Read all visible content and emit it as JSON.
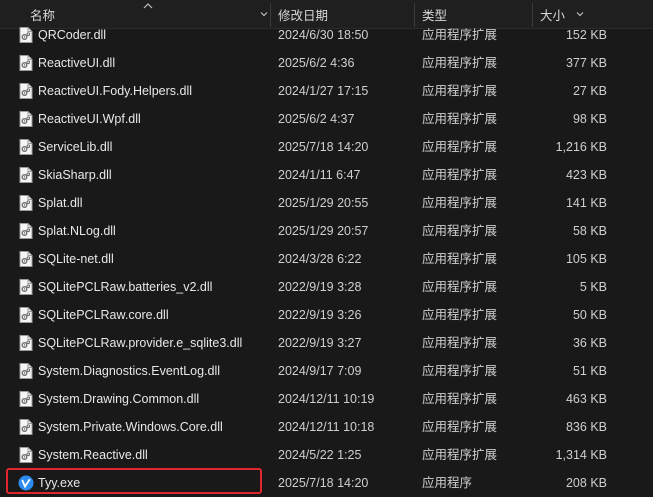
{
  "columns": {
    "name": "名称",
    "date": "修改日期",
    "type": "类型",
    "size": "大小"
  },
  "files": [
    {
      "name": "QRCoder.dll",
      "date": "2024/6/30 18:50",
      "type": "应用程序扩展",
      "size": "152 KB",
      "icon": "dll-icon"
    },
    {
      "name": "ReactiveUI.dll",
      "date": "2025/6/2 4:36",
      "type": "应用程序扩展",
      "size": "377 KB",
      "icon": "dll-icon"
    },
    {
      "name": "ReactiveUI.Fody.Helpers.dll",
      "date": "2024/1/27 17:15",
      "type": "应用程序扩展",
      "size": "27 KB",
      "icon": "dll-icon"
    },
    {
      "name": "ReactiveUI.Wpf.dll",
      "date": "2025/6/2 4:37",
      "type": "应用程序扩展",
      "size": "98 KB",
      "icon": "dll-icon"
    },
    {
      "name": "ServiceLib.dll",
      "date": "2025/7/18 14:20",
      "type": "应用程序扩展",
      "size": "1,216 KB",
      "icon": "dll-icon"
    },
    {
      "name": "SkiaSharp.dll",
      "date": "2024/1/11 6:47",
      "type": "应用程序扩展",
      "size": "423 KB",
      "icon": "dll-icon"
    },
    {
      "name": "Splat.dll",
      "date": "2025/1/29 20:55",
      "type": "应用程序扩展",
      "size": "141 KB",
      "icon": "dll-icon"
    },
    {
      "name": "Splat.NLog.dll",
      "date": "2025/1/29 20:57",
      "type": "应用程序扩展",
      "size": "58 KB",
      "icon": "dll-icon"
    },
    {
      "name": "SQLite-net.dll",
      "date": "2024/3/28 6:22",
      "type": "应用程序扩展",
      "size": "105 KB",
      "icon": "dll-icon"
    },
    {
      "name": "SQLitePCLRaw.batteries_v2.dll",
      "date": "2022/9/19 3:28",
      "type": "应用程序扩展",
      "size": "5 KB",
      "icon": "dll-icon"
    },
    {
      "name": "SQLitePCLRaw.core.dll",
      "date": "2022/9/19 3:26",
      "type": "应用程序扩展",
      "size": "50 KB",
      "icon": "dll-icon"
    },
    {
      "name": "SQLitePCLRaw.provider.e_sqlite3.dll",
      "date": "2022/9/19 3:27",
      "type": "应用程序扩展",
      "size": "36 KB",
      "icon": "dll-icon"
    },
    {
      "name": "System.Diagnostics.EventLog.dll",
      "date": "2024/9/17 7:09",
      "type": "应用程序扩展",
      "size": "51 KB",
      "icon": "dll-icon"
    },
    {
      "name": "System.Drawing.Common.dll",
      "date": "2024/12/11 10:19",
      "type": "应用程序扩展",
      "size": "463 KB",
      "icon": "dll-icon"
    },
    {
      "name": "System.Private.Windows.Core.dll",
      "date": "2024/12/11 10:18",
      "type": "应用程序扩展",
      "size": "836 KB",
      "icon": "dll-icon"
    },
    {
      "name": "System.Reactive.dll",
      "date": "2024/5/22 1:25",
      "type": "应用程序扩展",
      "size": "1,314 KB",
      "icon": "dll-icon"
    },
    {
      "name": "Tyy.exe",
      "date": "2025/7/18 14:20",
      "type": "应用程序",
      "size": "208 KB",
      "icon": "app-exe-icon"
    }
  ],
  "colors": {
    "highlight": "#e0262d",
    "background": "#191919",
    "exe_icon": "#2d8cf0"
  }
}
